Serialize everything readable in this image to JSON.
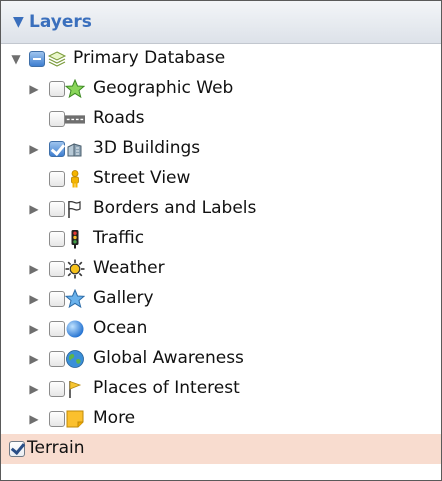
{
  "panel": {
    "title": "Layers"
  },
  "layers": {
    "root": "Primary Database",
    "items": [
      "Geographic Web",
      "Roads",
      "3D Buildings",
      "Street View",
      "Borders and Labels",
      "Traffic",
      "Weather",
      "Gallery",
      "Ocean",
      "Global Awareness",
      "Places of Interest",
      "More"
    ],
    "terrain": "Terrain"
  },
  "colors": {
    "accent": "#3a6fbd",
    "selection": "#f8dccf"
  }
}
